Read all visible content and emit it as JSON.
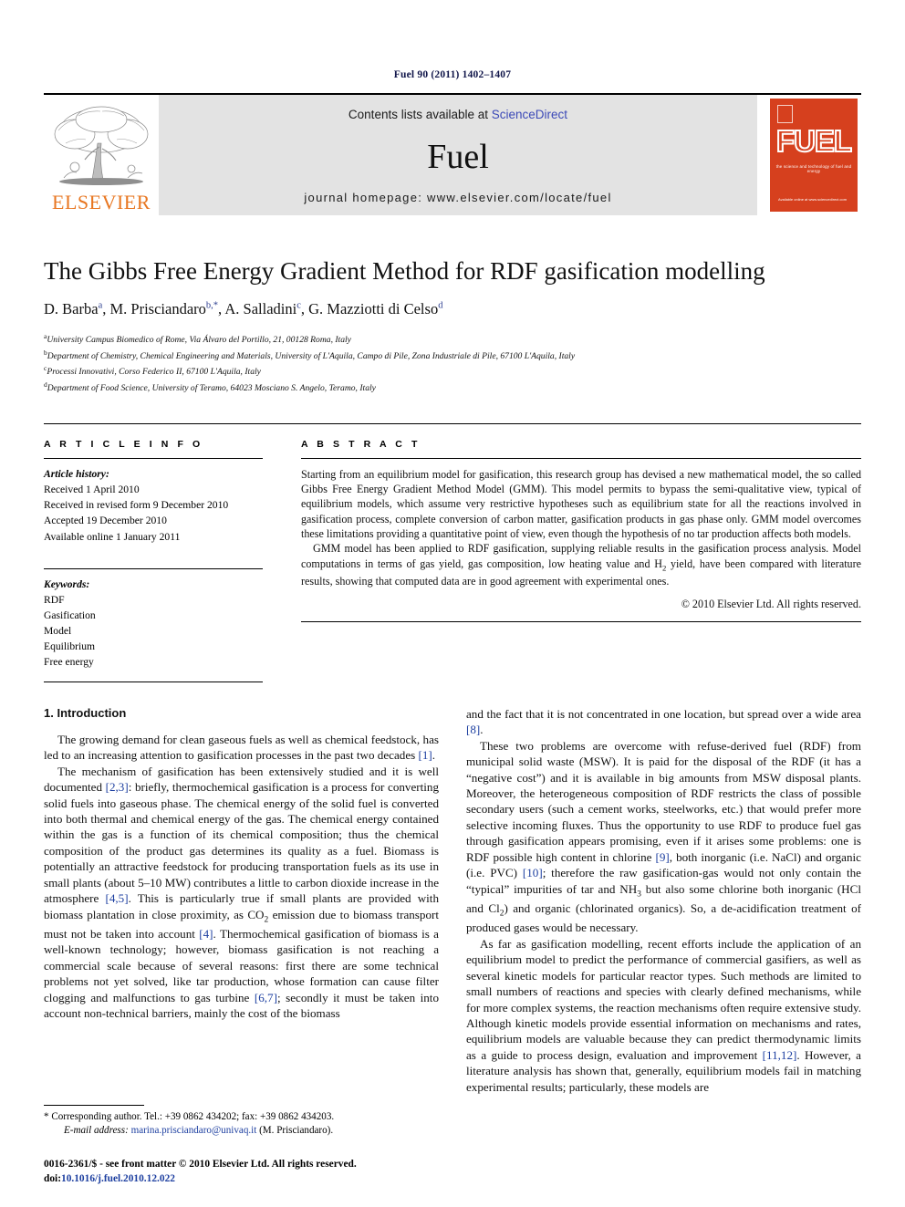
{
  "running_head": "Fuel 90 (2011) 1402–1407",
  "masthead": {
    "contents_prefix": "Contents lists available at",
    "sciencedirect": "ScienceDirect",
    "journal_name": "Fuel",
    "homepage": "journal homepage: www.elsevier.com/locate/fuel",
    "publisher_word": "ELSEVIER",
    "cover_title": "FUEL",
    "cover_subtitle": "the science and technology of fuel and energy",
    "cover_footer": "Available online at www.sciencedirect.com",
    "accent_orange": "#e87722",
    "cover_red": "#d6401e",
    "link_blue": "#3b49b7"
  },
  "article": {
    "title": "The Gibbs Free Energy Gradient Method for RDF gasification modelling",
    "authors": [
      {
        "name": "D. Barba",
        "sup": "a"
      },
      {
        "name": "M. Prisciandaro",
        "sup": "b,*"
      },
      {
        "name": "A. Salladini",
        "sup": "c"
      },
      {
        "name": "G. Mazziotti di Celso",
        "sup": "d"
      }
    ],
    "affiliations": [
      {
        "label": "a",
        "text": "University Campus Biomedico of Rome, Via Álvaro del Portillo, 21, 00128 Roma, Italy"
      },
      {
        "label": "b",
        "text": "Department of Chemistry, Chemical Engineering and Materials, University of L'Aquila, Campo di Pile, Zona Industriale di Pile, 67100 L'Aquila, Italy"
      },
      {
        "label": "c",
        "text": "Processi Innovativi, Corso Federico II, 67100 L'Aquila, Italy"
      },
      {
        "label": "d",
        "text": "Department of Food Science, University of Teramo, 64023 Mosciano S. Angelo, Teramo, Italy"
      }
    ]
  },
  "article_info": {
    "heading": "A R T I C L E  I N F O",
    "history_label": "Article history:",
    "history": [
      "Received 1 April 2010",
      "Received in revised form 9 December 2010",
      "Accepted 19 December 2010",
      "Available online 1 January 2011"
    ],
    "keywords_label": "Keywords:",
    "keywords": [
      "RDF",
      "Gasification",
      "Model",
      "Equilibrium",
      "Free energy"
    ]
  },
  "abstract": {
    "heading": "A B S T R A C T",
    "paragraph1": "Starting from an equilibrium model for gasification, this research group has devised a new mathematical model, the so called Gibbs Free Energy Gradient Method Model (GMM). This model permits to bypass the semi-qualitative view, typical of equilibrium models, which assume very restrictive hypotheses such as equilibrium state for all the reactions involved in gasification process, complete conversion of carbon matter, gasification products in gas phase only. GMM model overcomes these limitations providing a quantitative point of view, even though the hypothesis of no tar production affects both models.",
    "paragraph2_pre": "GMM model has been applied to RDF gasification, supplying reliable results in the gasification process analysis. Model computations in terms of gas yield, gas composition, low heating value and H",
    "paragraph2_sub": "2",
    "paragraph2_post": " yield, have been compared with literature results, showing that computed data are in good agreement with experimental ones.",
    "copyright": "© 2010 Elsevier Ltd. All rights reserved."
  },
  "introduction": {
    "section_title": "1. Introduction",
    "left": {
      "p1_pre": "The growing demand for clean gaseous fuels as well as chemical feedstock, has led to an increasing attention to gasification processes in the past two decades ",
      "p1_ref": "[1]",
      "p1_post": ".",
      "p2_a": "The mechanism of gasification has been extensively studied and it is well documented ",
      "p2_ref1": "[2,3]",
      "p2_b": ": briefly, thermochemical gasification is a process for converting solid fuels into gaseous phase. The chemical energy of the solid fuel is converted into both thermal and chemical energy of the gas. The chemical energy contained within the gas is a function of its chemical composition; thus the chemical composition of the product gas determines its quality as a fuel. Biomass is potentially an attractive feedstock for producing transportation fuels as its use in small plants (about 5–10 MW) contributes a little to carbon dioxide increase in the atmosphere ",
      "p2_ref2": "[4,5]",
      "p2_c": ". This is particularly true if small plants are provided with biomass plantation in close proximity, as CO",
      "p2_sub": "2",
      "p2_d": " emission due to biomass transport must not be taken into account ",
      "p2_ref3": "[4]",
      "p2_e": ". Thermochemical gasification of biomass is a well-known technology; however, biomass gasification is not reaching a commercial scale because of several reasons: first there are some technical problems not yet solved, like tar production, whose formation can cause filter clogging and malfunctions to gas turbine ",
      "p2_ref4": "[6,7]",
      "p2_f": "; secondly it must be taken into account non-technical barriers, mainly the cost of the biomass"
    },
    "right": {
      "p0_a": "and the fact that it is not concentrated in one location, but spread over a wide area ",
      "p0_ref": "[8]",
      "p0_b": ".",
      "p1_a": "These two problems are overcome with refuse-derived fuel (RDF) from municipal solid waste (MSW). It is paid for the disposal of the RDF (it has a “negative cost”) and it is available in big amounts from MSW disposal plants. Moreover, the heterogeneous composition of RDF restricts the class of possible secondary users (such a cement works, steelworks, etc.) that would prefer more selective incoming fluxes. Thus the opportunity to use RDF to produce fuel gas through gasification appears promising, even if it arises some problems: one is RDF possible high content in chlorine ",
      "p1_ref1": "[9]",
      "p1_b": ", both inorganic (i.e. NaCl) and organic (i.e. PVC) ",
      "p1_ref2": "[10]",
      "p1_c": "; therefore the raw gasification-gas would not only contain the “typical” impurities of tar and NH",
      "p1_sub1": "3",
      "p1_d": " but also some chlorine both inorganic (HCl and Cl",
      "p1_sub2": "2",
      "p1_e": ") and organic (chlorinated organics). So, a de-acidification treatment of produced gases would be necessary.",
      "p2_a": "As far as gasification modelling, recent efforts include the application of an equilibrium model to predict the performance of commercial gasifiers, as well as several kinetic models for particular reactor types. Such methods are limited to small numbers of reactions and species with clearly defined mechanisms, while for more complex systems, the reaction mechanisms often require extensive study. Although kinetic models provide essential information on mechanisms and rates, equilibrium models are valuable because they can predict thermodynamic limits as a guide to process design, evaluation and improvement ",
      "p2_ref": "[11,12]",
      "p2_b": ". However, a literature analysis has shown that, generally, equilibrium models fail in matching experimental results; particularly, these models are"
    }
  },
  "footnote": {
    "star": "*",
    "corresponding": "Corresponding author. Tel.: +39 0862 434202; fax: +39 0862 434203.",
    "email_label": "E-mail address:",
    "email": "marina.prisciandaro@univaq.it",
    "email_person": "(M. Prisciandaro)."
  },
  "imprint": {
    "line1": "0016-2361/$ - see front matter © 2010 Elsevier Ltd. All rights reserved.",
    "doi_label": "doi:",
    "doi_value": "10.1016/j.fuel.2010.12.022"
  }
}
